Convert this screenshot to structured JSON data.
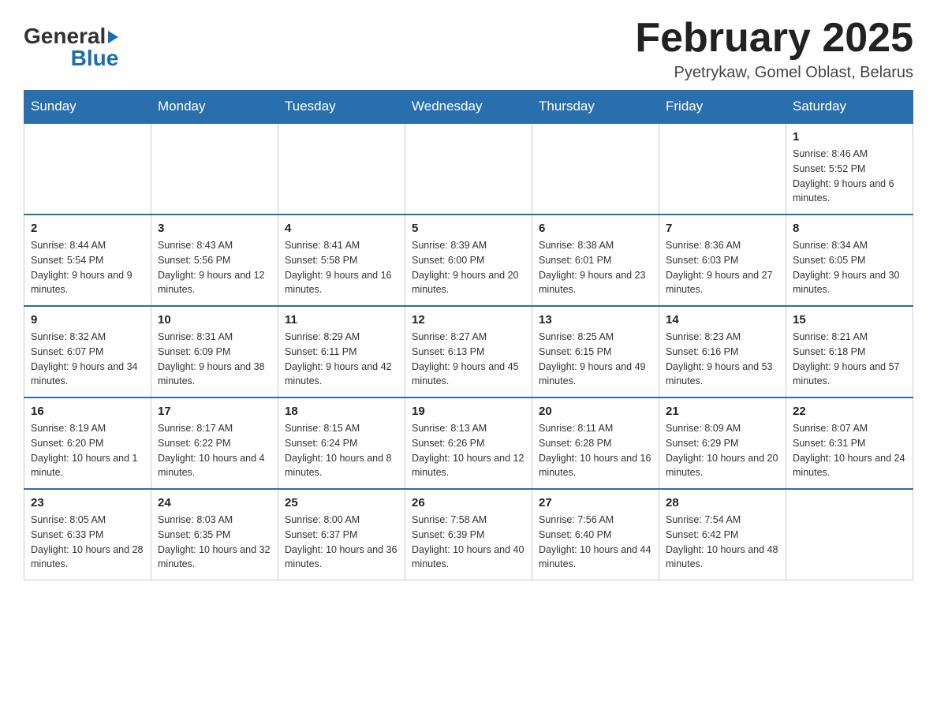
{
  "header": {
    "logo_general": "General",
    "logo_blue": "Blue",
    "title": "February 2025",
    "location": "Pyetrykaw, Gomel Oblast, Belarus"
  },
  "days_of_week": [
    "Sunday",
    "Monday",
    "Tuesday",
    "Wednesday",
    "Thursday",
    "Friday",
    "Saturday"
  ],
  "weeks": [
    [
      {
        "day": "",
        "info": ""
      },
      {
        "day": "",
        "info": ""
      },
      {
        "day": "",
        "info": ""
      },
      {
        "day": "",
        "info": ""
      },
      {
        "day": "",
        "info": ""
      },
      {
        "day": "",
        "info": ""
      },
      {
        "day": "1",
        "info": "Sunrise: 8:46 AM\nSunset: 5:52 PM\nDaylight: 9 hours and 6 minutes."
      }
    ],
    [
      {
        "day": "2",
        "info": "Sunrise: 8:44 AM\nSunset: 5:54 PM\nDaylight: 9 hours and 9 minutes."
      },
      {
        "day": "3",
        "info": "Sunrise: 8:43 AM\nSunset: 5:56 PM\nDaylight: 9 hours and 12 minutes."
      },
      {
        "day": "4",
        "info": "Sunrise: 8:41 AM\nSunset: 5:58 PM\nDaylight: 9 hours and 16 minutes."
      },
      {
        "day": "5",
        "info": "Sunrise: 8:39 AM\nSunset: 6:00 PM\nDaylight: 9 hours and 20 minutes."
      },
      {
        "day": "6",
        "info": "Sunrise: 8:38 AM\nSunset: 6:01 PM\nDaylight: 9 hours and 23 minutes."
      },
      {
        "day": "7",
        "info": "Sunrise: 8:36 AM\nSunset: 6:03 PM\nDaylight: 9 hours and 27 minutes."
      },
      {
        "day": "8",
        "info": "Sunrise: 8:34 AM\nSunset: 6:05 PM\nDaylight: 9 hours and 30 minutes."
      }
    ],
    [
      {
        "day": "9",
        "info": "Sunrise: 8:32 AM\nSunset: 6:07 PM\nDaylight: 9 hours and 34 minutes."
      },
      {
        "day": "10",
        "info": "Sunrise: 8:31 AM\nSunset: 6:09 PM\nDaylight: 9 hours and 38 minutes."
      },
      {
        "day": "11",
        "info": "Sunrise: 8:29 AM\nSunset: 6:11 PM\nDaylight: 9 hours and 42 minutes."
      },
      {
        "day": "12",
        "info": "Sunrise: 8:27 AM\nSunset: 6:13 PM\nDaylight: 9 hours and 45 minutes."
      },
      {
        "day": "13",
        "info": "Sunrise: 8:25 AM\nSunset: 6:15 PM\nDaylight: 9 hours and 49 minutes."
      },
      {
        "day": "14",
        "info": "Sunrise: 8:23 AM\nSunset: 6:16 PM\nDaylight: 9 hours and 53 minutes."
      },
      {
        "day": "15",
        "info": "Sunrise: 8:21 AM\nSunset: 6:18 PM\nDaylight: 9 hours and 57 minutes."
      }
    ],
    [
      {
        "day": "16",
        "info": "Sunrise: 8:19 AM\nSunset: 6:20 PM\nDaylight: 10 hours and 1 minute."
      },
      {
        "day": "17",
        "info": "Sunrise: 8:17 AM\nSunset: 6:22 PM\nDaylight: 10 hours and 4 minutes."
      },
      {
        "day": "18",
        "info": "Sunrise: 8:15 AM\nSunset: 6:24 PM\nDaylight: 10 hours and 8 minutes."
      },
      {
        "day": "19",
        "info": "Sunrise: 8:13 AM\nSunset: 6:26 PM\nDaylight: 10 hours and 12 minutes."
      },
      {
        "day": "20",
        "info": "Sunrise: 8:11 AM\nSunset: 6:28 PM\nDaylight: 10 hours and 16 minutes."
      },
      {
        "day": "21",
        "info": "Sunrise: 8:09 AM\nSunset: 6:29 PM\nDaylight: 10 hours and 20 minutes."
      },
      {
        "day": "22",
        "info": "Sunrise: 8:07 AM\nSunset: 6:31 PM\nDaylight: 10 hours and 24 minutes."
      }
    ],
    [
      {
        "day": "23",
        "info": "Sunrise: 8:05 AM\nSunset: 6:33 PM\nDaylight: 10 hours and 28 minutes."
      },
      {
        "day": "24",
        "info": "Sunrise: 8:03 AM\nSunset: 6:35 PM\nDaylight: 10 hours and 32 minutes."
      },
      {
        "day": "25",
        "info": "Sunrise: 8:00 AM\nSunset: 6:37 PM\nDaylight: 10 hours and 36 minutes."
      },
      {
        "day": "26",
        "info": "Sunrise: 7:58 AM\nSunset: 6:39 PM\nDaylight: 10 hours and 40 minutes."
      },
      {
        "day": "27",
        "info": "Sunrise: 7:56 AM\nSunset: 6:40 PM\nDaylight: 10 hours and 44 minutes."
      },
      {
        "day": "28",
        "info": "Sunrise: 7:54 AM\nSunset: 6:42 PM\nDaylight: 10 hours and 48 minutes."
      },
      {
        "day": "",
        "info": ""
      }
    ]
  ]
}
